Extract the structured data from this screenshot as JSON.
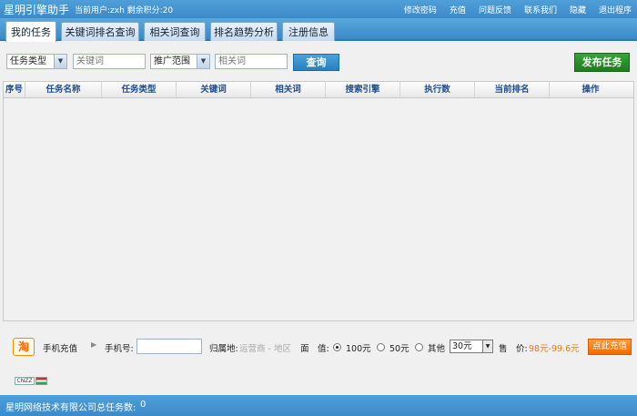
{
  "app": {
    "title": "星明引擎助手",
    "user_info": "当前用户:zxh  剩余积分:20"
  },
  "top_links": [
    "修改密码",
    "充值",
    "问题反馈",
    "联系我们",
    "隐藏",
    "退出程序"
  ],
  "tabs": [
    {
      "label": "我的任务",
      "active": true
    },
    {
      "label": "关键词排名查询",
      "active": false
    },
    {
      "label": "相关词查询",
      "active": false
    },
    {
      "label": "排名趋势分析",
      "active": false
    },
    {
      "label": "注册信息",
      "active": false
    }
  ],
  "filters": {
    "task_type": "任务类型",
    "keyword_placeholder": "关键词",
    "promo_range": "推广范围",
    "related_placeholder": "相关词",
    "query_label": "查询",
    "publish_label": "发布任务"
  },
  "grid": {
    "columns": [
      "序号",
      "任务名称",
      "任务类型",
      "关键词",
      "相关词",
      "搜索引擎",
      "执行数",
      "当前排名",
      "操作"
    ]
  },
  "recharge": {
    "logo_text": "淘",
    "title": "手机充值",
    "phone_label": "手机号:",
    "location_label": "归属地:",
    "location_value": "运营商 - 地区",
    "face_value_label": "面　值:",
    "option_100": "100元",
    "option_50": "50元",
    "option_other": "其他",
    "other_amount": "30元",
    "price_label": "售　价:",
    "price_value": "98元-99.6元",
    "pay_label": "点此充值",
    "accent_color": "#f07a00"
  },
  "footer_badge": "CNZZ",
  "status": {
    "company": "星明网络技术有限公司",
    "total_tasks_label": "总任务数:",
    "total_tasks": "0"
  }
}
